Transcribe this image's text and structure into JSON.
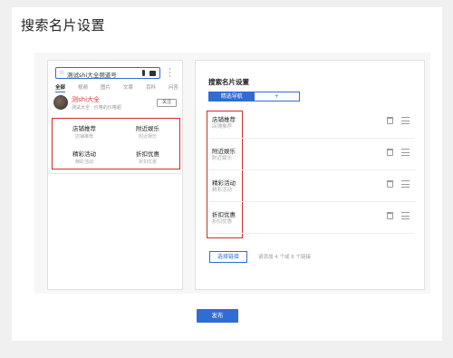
{
  "page": {
    "title": "搜索名片设置"
  },
  "preview": {
    "search_icon": "wechat-search-icon",
    "search_glyph": "☆",
    "search_query": "测试shi大全频道号",
    "tabs": [
      "全部",
      "视频",
      "图片",
      "文章",
      "百科",
      "问答"
    ],
    "account": {
      "name": "测shi大全",
      "desc": "测试大全 · 价格的价格超",
      "follow_label": "关注"
    },
    "menu": [
      {
        "title": "店铺推荐",
        "subtitle": "店铺推荐"
      },
      {
        "title": "附近娱乐",
        "subtitle": "附近娱乐"
      },
      {
        "title": "精彩活动",
        "subtitle": "精彩活动"
      },
      {
        "title": "折扣优惠",
        "subtitle": "折扣优惠"
      }
    ]
  },
  "settings": {
    "title": "搜索名片设置",
    "nav_tabs": {
      "active": "精选导航",
      "add": "+"
    },
    "items": [
      {
        "title": "店铺推荐",
        "subtitle": "店铺推荐"
      },
      {
        "title": "附近娱乐",
        "subtitle": "附近娱乐"
      },
      {
        "title": "精彩活动",
        "subtitle": "精彩活动"
      },
      {
        "title": "折扣优惠",
        "subtitle": "折扣优惠"
      }
    ],
    "select_link_label": "选择链接",
    "hint": "请添加 4 个或 6 个链接"
  },
  "footer": {
    "publish_label": "发布"
  },
  "colors": {
    "accent": "#2f6cd4",
    "highlight": "#d32b2b"
  }
}
